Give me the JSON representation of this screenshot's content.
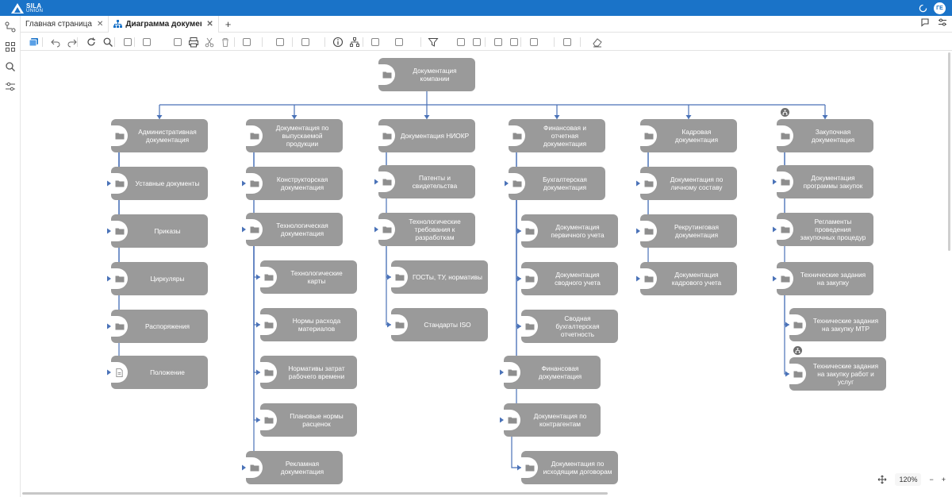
{
  "brand": {
    "name": "SILA",
    "sub": "UNION"
  },
  "user": {
    "initials": "ГЕ"
  },
  "tabs": [
    {
      "label": "Главная страница",
      "active": false
    },
    {
      "label": "Диаграмма документа",
      "active": true
    }
  ],
  "zoom": {
    "level": "120%",
    "minus": "−",
    "plus": "+"
  },
  "colors": {
    "topbar": "#1a73c8",
    "node": "#9a9a9a",
    "edge": "#4a72b8"
  },
  "diagram": {
    "nodes": [
      {
        "id": "root",
        "label": "Документация компании",
        "icon": "folder"
      },
      {
        "id": "c1",
        "label": "Административная документация",
        "icon": "folder"
      },
      {
        "id": "c1a",
        "label": "Уставные документы",
        "icon": "folder"
      },
      {
        "id": "c1b",
        "label": "Приказы",
        "icon": "folder"
      },
      {
        "id": "c1c",
        "label": "Циркуляры",
        "icon": "folder"
      },
      {
        "id": "c1d",
        "label": "Распоряжения",
        "icon": "folder"
      },
      {
        "id": "c1e",
        "label": "Положение",
        "icon": "document"
      },
      {
        "id": "c2",
        "label": "Документация по выпускаемой продукции",
        "icon": "folder"
      },
      {
        "id": "c2a",
        "label": "Конструкторская документация",
        "icon": "folder"
      },
      {
        "id": "c2b",
        "label": "Технологическая документация",
        "icon": "folder"
      },
      {
        "id": "c2b1",
        "label": "Технологические карты",
        "icon": "folder"
      },
      {
        "id": "c2b2",
        "label": "Нормы расхода материалов",
        "icon": "folder"
      },
      {
        "id": "c2b3",
        "label": "Нормативы затрат рабочего времени",
        "icon": "folder"
      },
      {
        "id": "c2b4",
        "label": "Плановые нормы расценок",
        "icon": "folder"
      },
      {
        "id": "c2c",
        "label": "Рекламная документация",
        "icon": "folder"
      },
      {
        "id": "c3",
        "label": "Документация НИОКР",
        "icon": "folder"
      },
      {
        "id": "c3a",
        "label": "Патенты и свидетельства",
        "icon": "folder"
      },
      {
        "id": "c3b",
        "label": "Технологические требования к разработкам",
        "icon": "folder"
      },
      {
        "id": "c3b1",
        "label": "ГОСТы, ТУ, нормативы",
        "icon": "folder"
      },
      {
        "id": "c3b2",
        "label": "Стандарты ISO",
        "icon": "folder"
      },
      {
        "id": "c4",
        "label": "Финансовая и отчетная документация",
        "icon": "folder"
      },
      {
        "id": "c4a",
        "label": "Бухгалтерская документация",
        "icon": "folder"
      },
      {
        "id": "c4a1",
        "label": "Документация первичного учета",
        "icon": "folder"
      },
      {
        "id": "c4a2",
        "label": "Документация сводного учета",
        "icon": "folder"
      },
      {
        "id": "c4a3",
        "label": "Сводная бухгалтерская отчетность",
        "icon": "folder"
      },
      {
        "id": "c4b",
        "label": "Финансовая документация",
        "icon": "folder"
      },
      {
        "id": "c4c",
        "label": "Документация по контрагентам",
        "icon": "folder"
      },
      {
        "id": "c4c1",
        "label": "Документация по исходящим договорам",
        "icon": "folder"
      },
      {
        "id": "c5",
        "label": "Кадровая документация",
        "icon": "folder"
      },
      {
        "id": "c5a",
        "label": "Документация по личному составу",
        "icon": "folder"
      },
      {
        "id": "c5b",
        "label": "Рекрутинговая документация",
        "icon": "folder"
      },
      {
        "id": "c5c",
        "label": "Документация кадрового учета",
        "icon": "folder"
      },
      {
        "id": "c6",
        "label": "Закупочная документация",
        "icon": "folder"
      },
      {
        "id": "c6a",
        "label": "Документация программы закупок",
        "icon": "folder"
      },
      {
        "id": "c6b",
        "label": "Регламенты проведения закупочных процедур",
        "icon": "folder"
      },
      {
        "id": "c6c",
        "label": "Технические задания на закупку",
        "icon": "folder"
      },
      {
        "id": "c6c1",
        "label": "Технические задания на закупку МТР",
        "icon": "folder"
      },
      {
        "id": "c6c2",
        "label": "Технические задания на закупку работ и услуг",
        "icon": "folder"
      }
    ],
    "edges": [
      [
        "root",
        "c1"
      ],
      [
        "root",
        "c2"
      ],
      [
        "root",
        "c3"
      ],
      [
        "root",
        "c4"
      ],
      [
        "root",
        "c5"
      ],
      [
        "root",
        "c6"
      ],
      [
        "c1",
        "c1a"
      ],
      [
        "c1",
        "c1b"
      ],
      [
        "c1",
        "c1c"
      ],
      [
        "c1",
        "c1d"
      ],
      [
        "c1",
        "c1e"
      ],
      [
        "c2",
        "c2a"
      ],
      [
        "c2",
        "c2b"
      ],
      [
        "c2",
        "c2c"
      ],
      [
        "c2b",
        "c2b1"
      ],
      [
        "c2b",
        "c2b2"
      ],
      [
        "c2b",
        "c2b3"
      ],
      [
        "c2b",
        "c2b4"
      ],
      [
        "c3",
        "c3a"
      ],
      [
        "c3",
        "c3b"
      ],
      [
        "c3b",
        "c3b1"
      ],
      [
        "c3b",
        "c3b2"
      ],
      [
        "c4",
        "c4a"
      ],
      [
        "c4",
        "c4b"
      ],
      [
        "c4",
        "c4c"
      ],
      [
        "c4a",
        "c4a1"
      ],
      [
        "c4a",
        "c4a2"
      ],
      [
        "c4a",
        "c4a3"
      ],
      [
        "c4c",
        "c4c1"
      ],
      [
        "c5",
        "c5a"
      ],
      [
        "c5",
        "c5b"
      ],
      [
        "c5",
        "c5c"
      ],
      [
        "c6",
        "c6a"
      ],
      [
        "c6",
        "c6b"
      ],
      [
        "c6",
        "c6c"
      ],
      [
        "c6c",
        "c6c1"
      ],
      [
        "c6c",
        "c6c2"
      ]
    ],
    "badges": [
      "c6",
      "c6c2"
    ]
  },
  "toolbar": [
    "layers-icon",
    "undo-icon",
    "redo-icon",
    "refresh-icon",
    "search-icon",
    "copy-icon",
    "new-page-icon",
    "duplicate-icon",
    "print-icon",
    "cut-icon",
    "delete-icon",
    "distribute-icon",
    "align-icon",
    "arrange-icon",
    "info-icon",
    "hierarchy-icon",
    "select-icon",
    "export-icon",
    "filter-icon",
    "collapse-icon",
    "expand-icon",
    "image-icon",
    "text-icon",
    "comment-icon",
    "format-icon",
    "eraser-icon"
  ]
}
